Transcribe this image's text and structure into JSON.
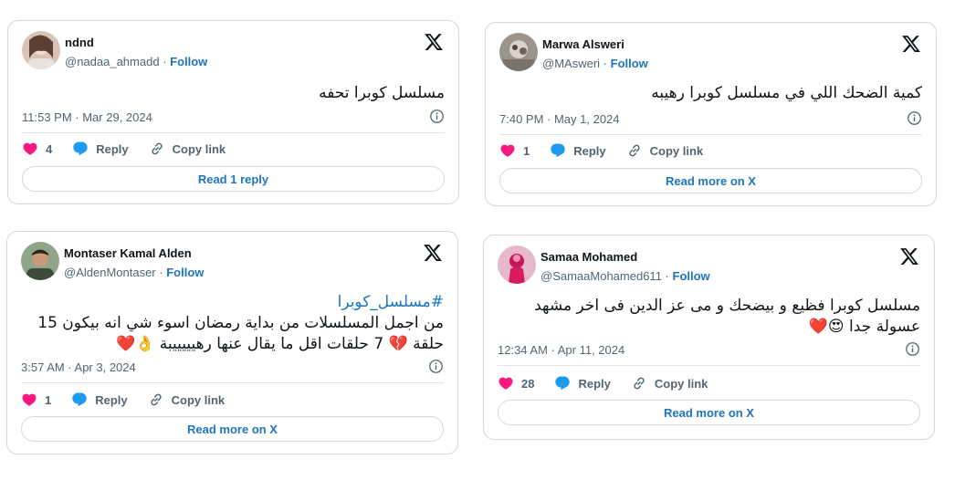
{
  "colors": {
    "link": "#1d74c0",
    "muted": "#536471",
    "heart": "#f91880",
    "reply": "#1d9bf0",
    "border": "#cfd9de"
  },
  "tweets": [
    {
      "author": "ndnd",
      "handle": "@nadaa_ahmadd",
      "follow": "Follow",
      "text": "مسلسل كوبرا تحفه",
      "timestamp": "11:53 PM · Mar 29, 2024",
      "likes": "4",
      "reply_label": "Reply",
      "copy_label": "Copy link",
      "cta": "Read 1 reply"
    },
    {
      "author": "Marwa Alsweri",
      "handle": "@MAsweri",
      "follow": "Follow",
      "text": "كمية الضحك اللي في مسلسل كوبرا رهيبه",
      "timestamp": "7:40 PM · May 1, 2024",
      "likes": "1",
      "reply_label": "Reply",
      "copy_label": "Copy link",
      "cta": "Read more on X"
    },
    {
      "author": "Montaser Kamal Alden",
      "handle": "@AldenMontaser",
      "follow": "Follow",
      "hashtag": "#مسلسل_كوبرا",
      "text_line1": "من اجمل المسلسلات من بداية رمضان اسوء شي انه بيكون 15",
      "text_line2": "حلقة 💔 7 حلقات اقل ما يقال عنها رهيييييبة 👌❤️",
      "timestamp": "3:57 AM · Apr 3, 2024",
      "likes": "1",
      "reply_label": "Reply",
      "copy_label": "Copy link",
      "cta": "Read more on X"
    },
    {
      "author": "Samaa Mohamed",
      "handle": "@SamaaMohamed611",
      "follow": "Follow",
      "text_line1": "مسلسل كوبرا فظيع و بيضحك و مى عز الدين فى اخر مشهد",
      "text_line2": "عسولة جدا 😍❤️",
      "timestamp": "12:34 AM · Apr 11, 2024",
      "likes": "28",
      "reply_label": "Reply",
      "copy_label": "Copy link",
      "cta": "Read more on X"
    }
  ],
  "separator": "·"
}
